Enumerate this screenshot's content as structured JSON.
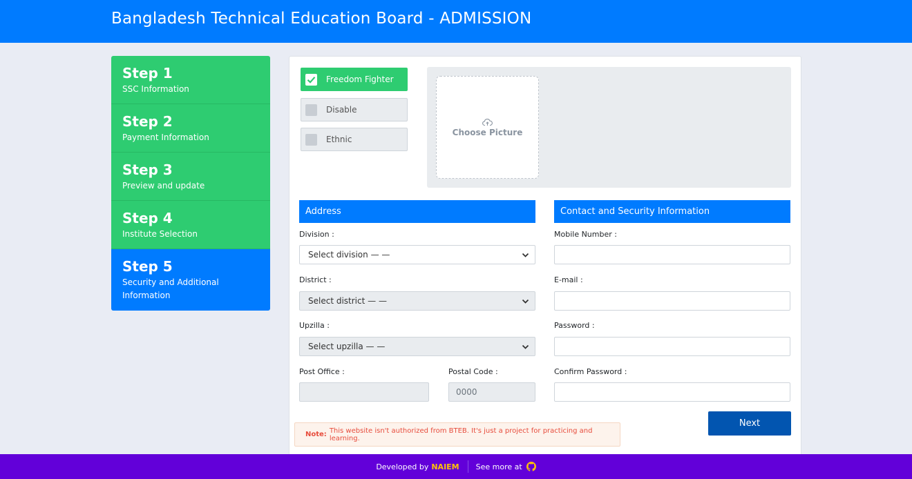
{
  "header": {
    "title": "Bangladesh Technical Education Board - ADMISSION"
  },
  "steps": [
    {
      "number": "Step 1",
      "label": "SSC Information"
    },
    {
      "number": "Step 2",
      "label": "Payment Information"
    },
    {
      "number": "Step 3",
      "label": "Preview and update"
    },
    {
      "number": "Step 4",
      "label": "Institute Selection"
    },
    {
      "number": "Step 5",
      "label": "Security and Additional Information"
    }
  ],
  "quota": {
    "freedom_fighter": {
      "label": "Freedom Fighter",
      "checked": true
    },
    "disable": {
      "label": "Disable",
      "checked": false
    },
    "ethnic": {
      "label": "Ethnic",
      "checked": false
    }
  },
  "photo": {
    "label": "Choose Picture"
  },
  "address": {
    "title": "Address",
    "division_label": "Division :",
    "division_value": "Select division — —",
    "district_label": "District :",
    "district_value": "Select district — —",
    "upzilla_label": "Upzilla :",
    "upzilla_value": "Select upzilla — —",
    "post_office_label": "Post Office :",
    "post_office_value": "",
    "postal_code_label": "Postal Code :",
    "postal_code_placeholder": "0000"
  },
  "contact": {
    "title": "Contact and Security Information",
    "mobile_label": "Mobile Number :",
    "email_label": "E-mail :",
    "password_label": "Password :",
    "confirm_label": "Confirm Password :"
  },
  "actions": {
    "next_label": "Next"
  },
  "note": {
    "prefix": "Note:",
    "text": "This website isn't authorized from BTEB. It's just a project for practicing and learning."
  },
  "footer": {
    "developed_by": "Developed by",
    "developer": "NAIEM",
    "see_more": "See more at"
  },
  "colors": {
    "primary": "#007bff",
    "success": "#2ecc71",
    "footer": "#6200d9",
    "accent": "#ffc107",
    "danger": "#e74c3c"
  }
}
